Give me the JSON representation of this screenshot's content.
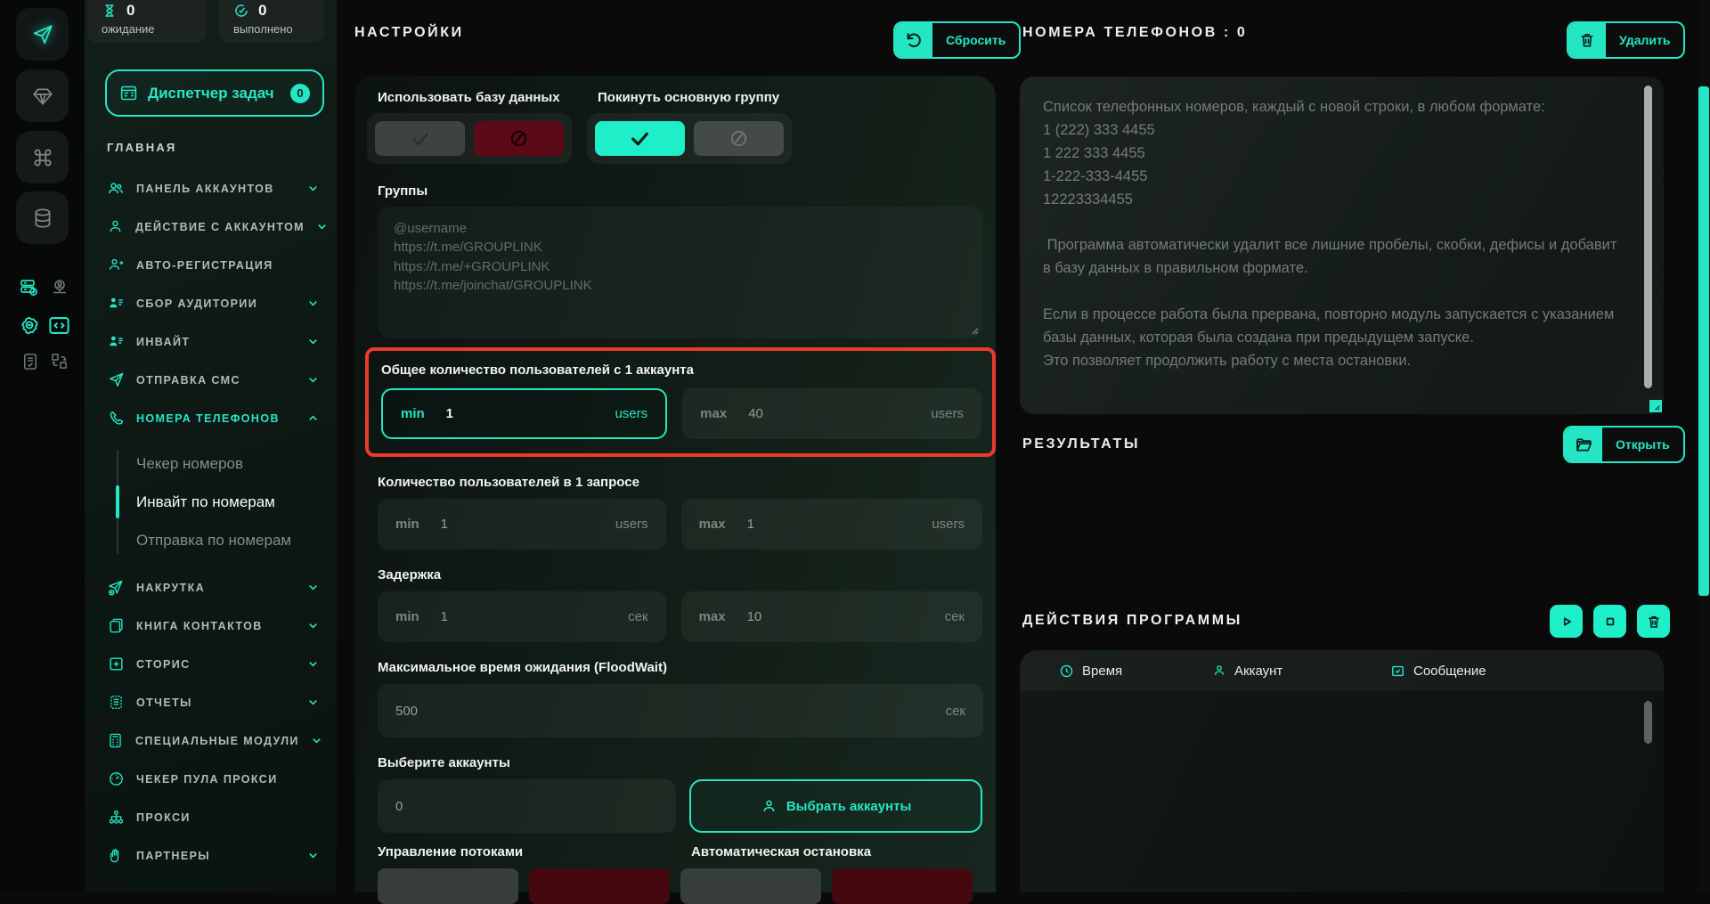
{
  "colors": {
    "accent": "#25e6c4",
    "accent-bright": "#1fefc9",
    "bg": "#0a0a0a",
    "danger": "#5c0a16",
    "highlight": "#e93a2c"
  },
  "sidebar": {
    "stats": [
      {
        "value": "0",
        "label": "ожидание"
      },
      {
        "value": "0",
        "label": "выполнено"
      }
    ],
    "task_manager": {
      "label": "Диспетчер задач",
      "badge": "0"
    },
    "section": "ГЛАВНАЯ",
    "items": [
      {
        "label": "ПАНЕЛЬ АККАУНТОВ"
      },
      {
        "label": "ДЕЙСТВИЕ С АККАУНТОМ"
      },
      {
        "label": "АВТО-РЕГИСТРАЦИЯ"
      },
      {
        "label": "СБОР АУДИТОРИИ"
      },
      {
        "label": "ИНВАЙТ"
      },
      {
        "label": "ОТПРАВКА СМС"
      },
      {
        "label": "НОМЕРА ТЕЛЕФОНОВ"
      },
      {
        "label": "НАКРУТКА"
      },
      {
        "label": "КНИГА КОНТАКТОВ"
      },
      {
        "label": "СТОРИС"
      },
      {
        "label": "ОТЧЕТЫ"
      },
      {
        "label": "СПЕЦИАЛЬНЫЕ МОДУЛИ"
      },
      {
        "label": "ЧЕКЕР ПУЛА ПРОКСИ"
      },
      {
        "label": "ПРОКСИ"
      },
      {
        "label": "ПАРТНЕРЫ"
      }
    ],
    "submenu": [
      {
        "label": "Чекер номеров"
      },
      {
        "label": "Инвайт по номерам"
      },
      {
        "label": "Отправка по номерам"
      }
    ]
  },
  "settings": {
    "title": "НАСТРОЙКИ",
    "reset_button": "Сбросить",
    "use_db": {
      "label": "Использовать базу данных"
    },
    "leave_group": {
      "label": "Покинуть основную группу"
    },
    "groups": {
      "label": "Группы",
      "placeholder": "@username\nhttps://t.me/GROUPLINK\nhttps://t.me/+GROUPLINK\nhttps://t.me/joinchat/GROUPLINK"
    },
    "total_users": {
      "label": "Общее количество пользователей с 1 аккаунта",
      "min_prefix": "min",
      "min_value": "1",
      "max_prefix": "max",
      "max_value": "40",
      "unit": "users"
    },
    "users_per_request": {
      "label": "Количество пользователей в 1 запросе",
      "min_prefix": "min",
      "min_value": "1",
      "max_prefix": "max",
      "max_value": "1",
      "unit": "users"
    },
    "delay": {
      "label": "Задержка",
      "min_prefix": "min",
      "min_value": "1",
      "max_prefix": "max",
      "max_value": "10",
      "unit": "сек"
    },
    "floodwait": {
      "label": "Максимальное время ожидания (FloodWait)",
      "value": "500",
      "unit": "сек"
    },
    "accounts": {
      "label": "Выберите аккаунты",
      "value": "0",
      "button": "Выбрать аккаунты"
    },
    "threads": {
      "label": "Управление потоками"
    },
    "autostop": {
      "label": "Автоматическая остановка"
    }
  },
  "phones": {
    "title": "НОМЕРА ТЕЛЕФОНОВ : 0",
    "delete_button": "Удалить",
    "placeholder": "Список телефонных номеров, каждый с новой строки, в любом формате:\n1 (222) 333 4455\n1 222 333 4455\n1-222-333-4455\n12223334455\n\n Программа автоматически удалит все лишние пробелы, скобки, дефисы и добавит в базу данных в правильном формате.\n\nЕсли в процессе работа была прервана, повторно модуль запускается с указанием базы данных, которая была создана при предыдущем запуске.\nЭто позволяет продолжить работу с места остановки."
  },
  "results": {
    "title": "РЕЗУЛЬТАТЫ",
    "open_button": "Открыть"
  },
  "program_actions": {
    "title": "ДЕЙСТВИЯ ПРОГРАММЫ",
    "columns": [
      {
        "label": "Время"
      },
      {
        "label": "Аккаунт"
      },
      {
        "label": "Сообщение"
      }
    ]
  }
}
